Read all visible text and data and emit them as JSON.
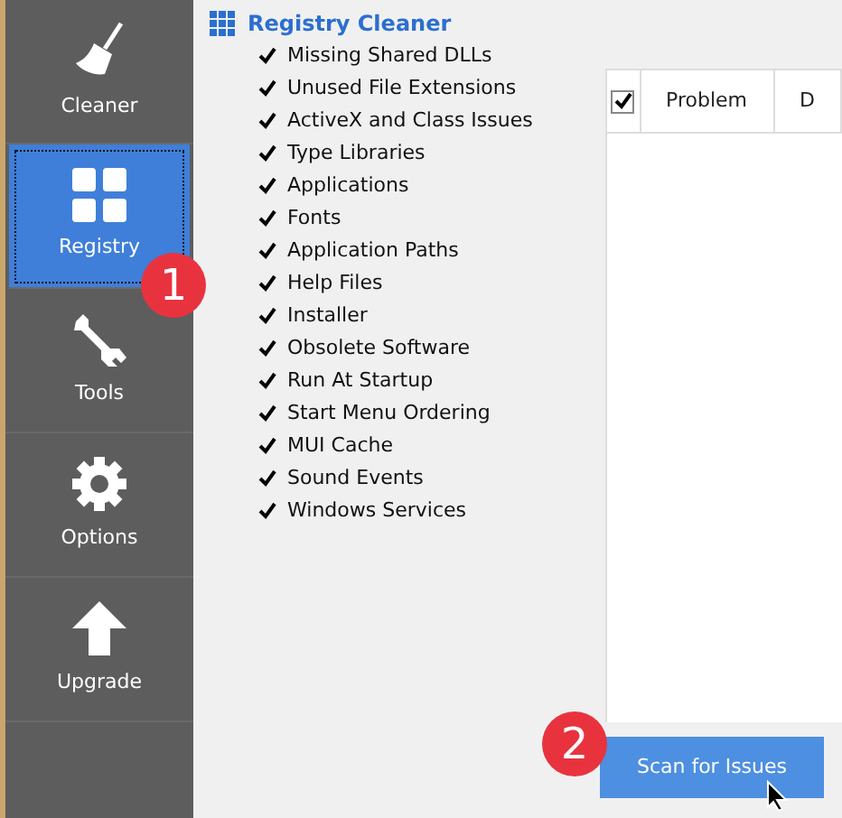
{
  "sidebar": {
    "items": [
      {
        "label": "Cleaner",
        "kind": "broom",
        "selected": false
      },
      {
        "label": "Registry",
        "kind": "grid",
        "selected": true
      },
      {
        "label": "Tools",
        "kind": "wrench",
        "selected": false
      },
      {
        "label": "Options",
        "kind": "gear",
        "selected": false
      },
      {
        "label": "Upgrade",
        "kind": "arrow",
        "selected": false
      }
    ]
  },
  "registry_cleaner": {
    "title": "Registry Cleaner",
    "items": [
      {
        "label": "Missing Shared DLLs",
        "checked": true
      },
      {
        "label": "Unused File Extensions",
        "checked": true
      },
      {
        "label": "ActiveX and Class Issues",
        "checked": true
      },
      {
        "label": "Type Libraries",
        "checked": true
      },
      {
        "label": "Applications",
        "checked": true
      },
      {
        "label": "Fonts",
        "checked": true
      },
      {
        "label": "Application Paths",
        "checked": true
      },
      {
        "label": "Help Files",
        "checked": true
      },
      {
        "label": "Installer",
        "checked": true
      },
      {
        "label": "Obsolete Software",
        "checked": true
      },
      {
        "label": "Run At Startup",
        "checked": true
      },
      {
        "label": "Start Menu Ordering",
        "checked": true
      },
      {
        "label": "MUI Cache",
        "checked": true
      },
      {
        "label": "Sound Events",
        "checked": true
      },
      {
        "label": "Windows Services",
        "checked": true
      }
    ]
  },
  "results_table": {
    "select_all_checked": true,
    "columns": [
      "Problem",
      "D"
    ]
  },
  "scan_button": "Scan for Issues",
  "callouts": [
    "1",
    "2"
  ]
}
